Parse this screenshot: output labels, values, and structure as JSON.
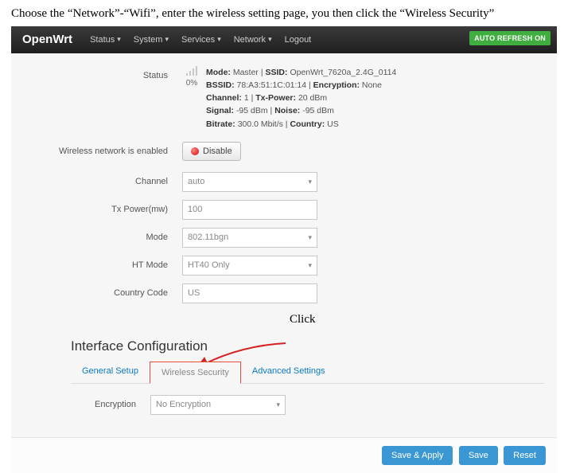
{
  "doc": {
    "intro": "Choose the “Network”-“Wifi”, enter the wireless setting page, you then click the “Wireless Security”"
  },
  "header": {
    "brand": "OpenWrt",
    "nav": {
      "status": "Status",
      "system": "System",
      "services": "Services",
      "network": "Network",
      "logout": "Logout"
    },
    "auto_refresh": "AUTO REFRESH ON"
  },
  "status": {
    "label": "Status",
    "pct": "0%",
    "mode_lbl": "Mode:",
    "mode": "Master",
    "ssid_lbl": "SSID:",
    "ssid": "OpenWrt_7620a_2.4G_0114",
    "bssid_lbl": "BSSID:",
    "bssid": "78:A3:51:1C:01:14",
    "enc_lbl": "Encryption:",
    "enc": "None",
    "channel_lbl": "Channel:",
    "channel": "1",
    "txp_lbl": "Tx-Power:",
    "txp": "20 dBm",
    "signal_lbl": "Signal:",
    "signal": "-95 dBm",
    "noise_lbl": "Noise:",
    "noise": "-95 dBm",
    "bitrate_lbl": "Bitrate:",
    "bitrate": "300.0 Mbit/s",
    "country_lbl": "Country:",
    "country": "US"
  },
  "wnet": {
    "label": "Wireless network is enabled",
    "disable": "Disable"
  },
  "fields": {
    "channel": {
      "label": "Channel",
      "value": "auto"
    },
    "txpower": {
      "label": "Tx Power(mw)",
      "value": "100"
    },
    "mode": {
      "label": "Mode",
      "value": "802.11bgn"
    },
    "htmode": {
      "label": "HT Mode",
      "value": "HT40 Only"
    },
    "cc": {
      "label": "Country Code",
      "value": "US"
    }
  },
  "iface": {
    "title": "Interface Configuration",
    "click_text": "Click",
    "tabs": {
      "general": "General Setup",
      "security": "Wireless Security",
      "advanced": "Advanced Settings"
    },
    "encryption": {
      "label": "Encryption",
      "value": "No Encryption"
    }
  },
  "footer": {
    "save_apply": "Save & Apply",
    "save": "Save",
    "reset": "Reset"
  }
}
